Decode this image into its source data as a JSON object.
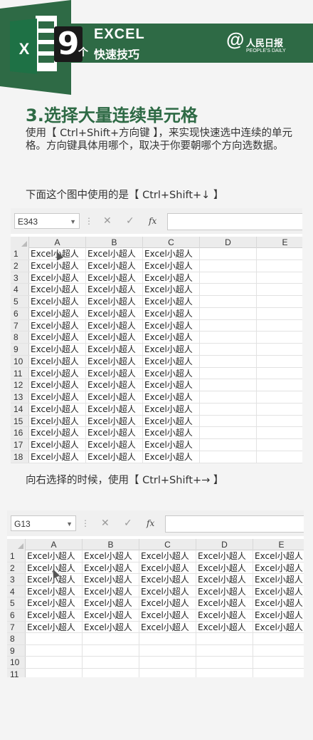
{
  "banner": {
    "number": "9",
    "unit": "个",
    "title": "EXCEL",
    "subtitle": "快速技巧",
    "icon_letter": "X",
    "logo_at": "@",
    "logo_name": "人民日报",
    "logo_sub": "PEOPLE'S DAILY"
  },
  "section": {
    "title": "3.选择大量连续单元格",
    "description": "使用【 Ctrl+Shift+方向键 】，来实现快速选中连续的单元格。方向键具体用哪个，取决于你要朝哪个方向选数据。",
    "caption_down": "下面这个图中使用的是【 Ctrl+Shift+↓ 】",
    "caption_right": "向右选择的时候，使用【 Ctrl+Shift+→ 】"
  },
  "sheet1": {
    "name_box": "E343",
    "columns": [
      "A",
      "B",
      "C",
      "D",
      "E"
    ],
    "rows": [
      "1",
      "2",
      "3",
      "4",
      "5",
      "6",
      "7",
      "8",
      "9",
      "10",
      "11",
      "12",
      "13",
      "14",
      "15",
      "16",
      "17",
      "18"
    ],
    "cell_text": "Excel小超人",
    "filled_columns": 3
  },
  "sheet2": {
    "name_box": "G13",
    "columns": [
      "A",
      "B",
      "C",
      "D",
      "E"
    ],
    "rows": [
      "1",
      "2",
      "3",
      "4",
      "5",
      "6",
      "7",
      "8",
      "9",
      "10",
      "11"
    ],
    "cell_text": "Excel小超人",
    "filled_columns": 5,
    "filled_rows": 7
  },
  "formula_bar": {
    "cancel_icon": "✕",
    "confirm_icon": "✓",
    "function_icon": "fx",
    "separator": "⋮"
  },
  "colors": {
    "brand_green": "#2e6a45",
    "excel_green": "#1e7145"
  }
}
